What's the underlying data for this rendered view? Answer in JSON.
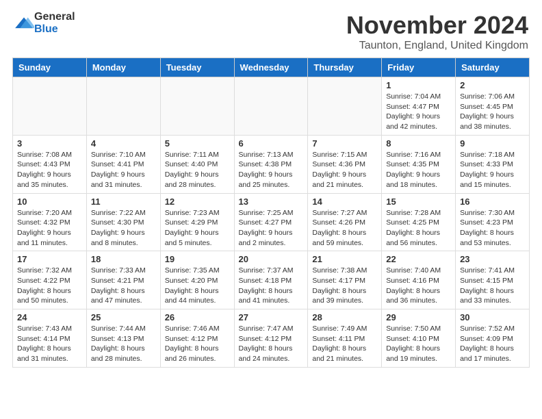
{
  "header": {
    "logo_general": "General",
    "logo_blue": "Blue",
    "month": "November 2024",
    "location": "Taunton, England, United Kingdom"
  },
  "days_of_week": [
    "Sunday",
    "Monday",
    "Tuesday",
    "Wednesday",
    "Thursday",
    "Friday",
    "Saturday"
  ],
  "weeks": [
    [
      {
        "day": "",
        "info": ""
      },
      {
        "day": "",
        "info": ""
      },
      {
        "day": "",
        "info": ""
      },
      {
        "day": "",
        "info": ""
      },
      {
        "day": "",
        "info": ""
      },
      {
        "day": "1",
        "info": "Sunrise: 7:04 AM\nSunset: 4:47 PM\nDaylight: 9 hours and 42 minutes."
      },
      {
        "day": "2",
        "info": "Sunrise: 7:06 AM\nSunset: 4:45 PM\nDaylight: 9 hours and 38 minutes."
      }
    ],
    [
      {
        "day": "3",
        "info": "Sunrise: 7:08 AM\nSunset: 4:43 PM\nDaylight: 9 hours and 35 minutes."
      },
      {
        "day": "4",
        "info": "Sunrise: 7:10 AM\nSunset: 4:41 PM\nDaylight: 9 hours and 31 minutes."
      },
      {
        "day": "5",
        "info": "Sunrise: 7:11 AM\nSunset: 4:40 PM\nDaylight: 9 hours and 28 minutes."
      },
      {
        "day": "6",
        "info": "Sunrise: 7:13 AM\nSunset: 4:38 PM\nDaylight: 9 hours and 25 minutes."
      },
      {
        "day": "7",
        "info": "Sunrise: 7:15 AM\nSunset: 4:36 PM\nDaylight: 9 hours and 21 minutes."
      },
      {
        "day": "8",
        "info": "Sunrise: 7:16 AM\nSunset: 4:35 PM\nDaylight: 9 hours and 18 minutes."
      },
      {
        "day": "9",
        "info": "Sunrise: 7:18 AM\nSunset: 4:33 PM\nDaylight: 9 hours and 15 minutes."
      }
    ],
    [
      {
        "day": "10",
        "info": "Sunrise: 7:20 AM\nSunset: 4:32 PM\nDaylight: 9 hours and 11 minutes."
      },
      {
        "day": "11",
        "info": "Sunrise: 7:22 AM\nSunset: 4:30 PM\nDaylight: 9 hours and 8 minutes."
      },
      {
        "day": "12",
        "info": "Sunrise: 7:23 AM\nSunset: 4:29 PM\nDaylight: 9 hours and 5 minutes."
      },
      {
        "day": "13",
        "info": "Sunrise: 7:25 AM\nSunset: 4:27 PM\nDaylight: 9 hours and 2 minutes."
      },
      {
        "day": "14",
        "info": "Sunrise: 7:27 AM\nSunset: 4:26 PM\nDaylight: 8 hours and 59 minutes."
      },
      {
        "day": "15",
        "info": "Sunrise: 7:28 AM\nSunset: 4:25 PM\nDaylight: 8 hours and 56 minutes."
      },
      {
        "day": "16",
        "info": "Sunrise: 7:30 AM\nSunset: 4:23 PM\nDaylight: 8 hours and 53 minutes."
      }
    ],
    [
      {
        "day": "17",
        "info": "Sunrise: 7:32 AM\nSunset: 4:22 PM\nDaylight: 8 hours and 50 minutes."
      },
      {
        "day": "18",
        "info": "Sunrise: 7:33 AM\nSunset: 4:21 PM\nDaylight: 8 hours and 47 minutes."
      },
      {
        "day": "19",
        "info": "Sunrise: 7:35 AM\nSunset: 4:20 PM\nDaylight: 8 hours and 44 minutes."
      },
      {
        "day": "20",
        "info": "Sunrise: 7:37 AM\nSunset: 4:18 PM\nDaylight: 8 hours and 41 minutes."
      },
      {
        "day": "21",
        "info": "Sunrise: 7:38 AM\nSunset: 4:17 PM\nDaylight: 8 hours and 39 minutes."
      },
      {
        "day": "22",
        "info": "Sunrise: 7:40 AM\nSunset: 4:16 PM\nDaylight: 8 hours and 36 minutes."
      },
      {
        "day": "23",
        "info": "Sunrise: 7:41 AM\nSunset: 4:15 PM\nDaylight: 8 hours and 33 minutes."
      }
    ],
    [
      {
        "day": "24",
        "info": "Sunrise: 7:43 AM\nSunset: 4:14 PM\nDaylight: 8 hours and 31 minutes."
      },
      {
        "day": "25",
        "info": "Sunrise: 7:44 AM\nSunset: 4:13 PM\nDaylight: 8 hours and 28 minutes."
      },
      {
        "day": "26",
        "info": "Sunrise: 7:46 AM\nSunset: 4:12 PM\nDaylight: 8 hours and 26 minutes."
      },
      {
        "day": "27",
        "info": "Sunrise: 7:47 AM\nSunset: 4:12 PM\nDaylight: 8 hours and 24 minutes."
      },
      {
        "day": "28",
        "info": "Sunrise: 7:49 AM\nSunset: 4:11 PM\nDaylight: 8 hours and 21 minutes."
      },
      {
        "day": "29",
        "info": "Sunrise: 7:50 AM\nSunset: 4:10 PM\nDaylight: 8 hours and 19 minutes."
      },
      {
        "day": "30",
        "info": "Sunrise: 7:52 AM\nSunset: 4:09 PM\nDaylight: 8 hours and 17 minutes."
      }
    ]
  ]
}
